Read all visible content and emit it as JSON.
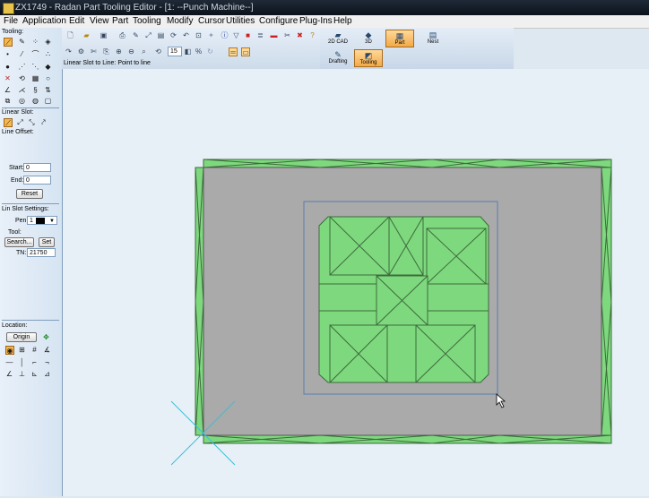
{
  "titlebar": {
    "title": "ZX1749 - Radan Part Tooling Editor - [1: --Punch Machine--]"
  },
  "menu": [
    "File",
    "Application",
    "Edit",
    "View",
    "Part",
    "Tooling",
    "Modify",
    "Cursor",
    "Utilities",
    "Configure",
    "Plug-Ins",
    "Help"
  ],
  "toolbar": {
    "status_text": "Linear Slot to Line: Point to line",
    "spin_value": "15"
  },
  "modes": {
    "cad": "2D CAD",
    "threed": "3D",
    "part": "Part",
    "nest": "Nest",
    "drafting": "Drafting",
    "tooling": "Tooling"
  },
  "left_panel": {
    "tooling_label": "Tooling:",
    "linear_slot_label": "Linear Slot:",
    "line_offset_label": "Line Offset:",
    "start_label": "Start:",
    "start_value": "0",
    "end_label": "End:",
    "end_value": "0",
    "reset_label": "Reset",
    "settings_label": "Lin Slot Settings:",
    "pen_label": "Pen:",
    "pen_value": "1",
    "tool_label": "Tool:",
    "search_label": "Search...",
    "set_label": "Set",
    "tn_label": "TN:",
    "tn_value": "21750",
    "location_label": "Location:",
    "origin_label": "Origin"
  },
  "colors": {
    "part_fill": "#aaaaaa",
    "tool_fill": "#7ed87e",
    "tool_stroke": "#3c6b3c",
    "highlight": "#f6b84a",
    "profile": "#5a7fb0"
  }
}
